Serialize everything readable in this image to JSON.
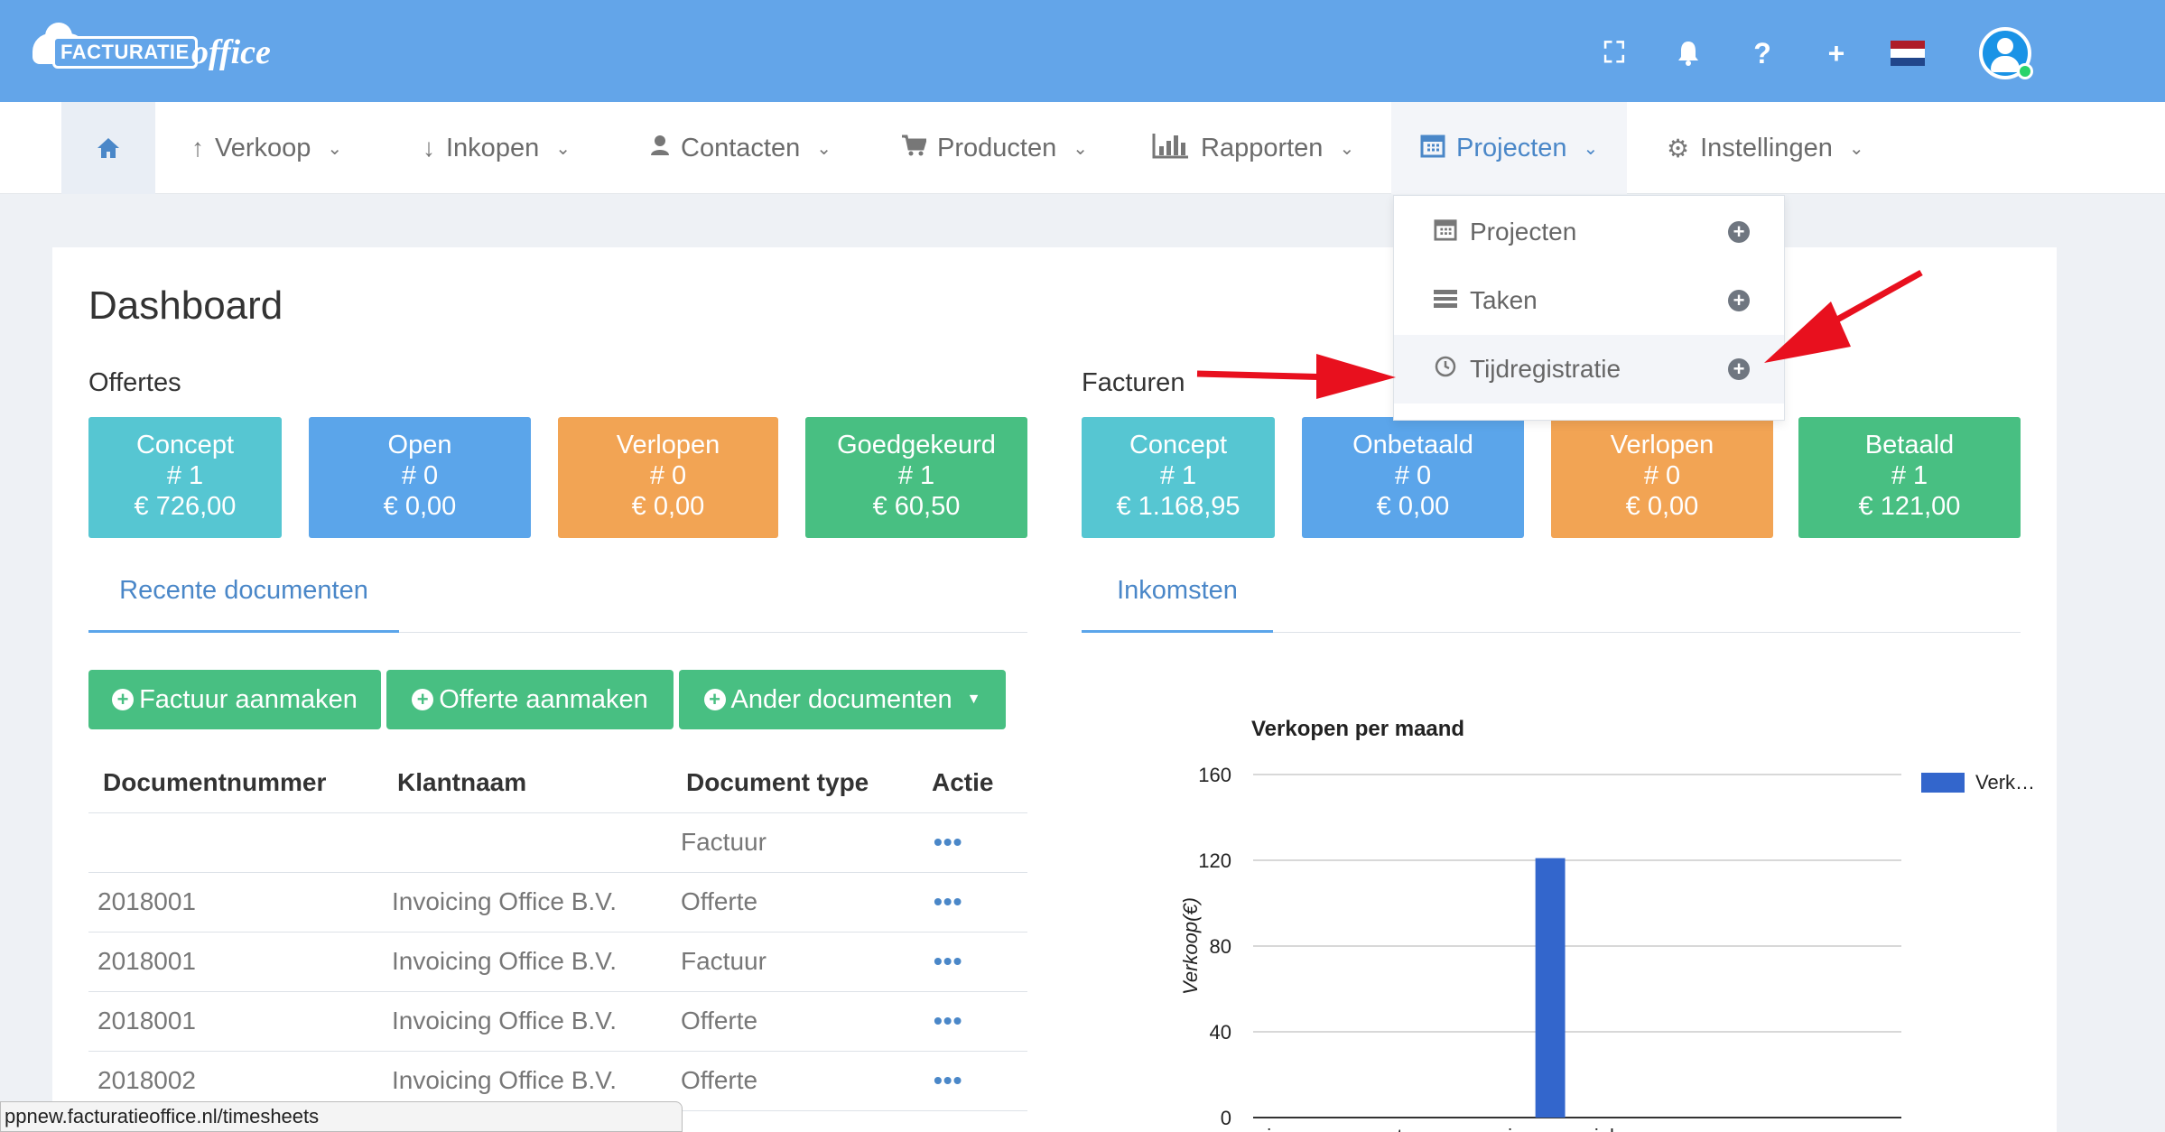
{
  "brand": {
    "box": "FACTURATIE",
    "script": "office"
  },
  "topbar": {
    "icons": [
      "fullscreen-icon",
      "bell-icon",
      "help-icon",
      "plus-icon"
    ],
    "icon_glyphs": [
      "⛶",
      "🔔",
      "?",
      "+"
    ],
    "flag_colors": [
      "#ae1c28",
      "#ffffff",
      "#21468b"
    ]
  },
  "nav": {
    "items": [
      {
        "label": "Verkoop",
        "icon": "arrow-up-icon",
        "glyph": "↑"
      },
      {
        "label": "Inkopen",
        "icon": "arrow-down-icon",
        "glyph": "↓"
      },
      {
        "label": "Contacten",
        "icon": "user-icon",
        "glyph": "👤"
      },
      {
        "label": "Producten",
        "icon": "cart-icon",
        "glyph": "🛒"
      },
      {
        "label": "Rapporten",
        "icon": "bar-chart-icon",
        "glyph": "📊"
      },
      {
        "label": "Projecten",
        "icon": "calendar-icon",
        "glyph": "📅"
      },
      {
        "label": "Instellingen",
        "icon": "gear-icon",
        "glyph": "⚙"
      }
    ]
  },
  "dropdown": {
    "items": [
      {
        "label": "Projecten",
        "icon": "calendar-icon",
        "glyph": "📅"
      },
      {
        "label": "Taken",
        "icon": "list-icon",
        "glyph": "☰"
      },
      {
        "label": "Tijdregistratie",
        "icon": "clock-icon",
        "glyph": "◷"
      }
    ]
  },
  "dashboard": {
    "title": "Dashboard",
    "offertes": {
      "label": "Offertes",
      "tiles": [
        {
          "name": "Concept",
          "count": "# 1",
          "amount": "€ 726,00"
        },
        {
          "name": "Open",
          "count": "# 0",
          "amount": "€ 0,00"
        },
        {
          "name": "Verlopen",
          "count": "# 0",
          "amount": "€ 0,00"
        },
        {
          "name": "Goedgekeurd",
          "count": "# 1",
          "amount": "€ 60,50"
        }
      ]
    },
    "facturen": {
      "label": "Facturen",
      "tiles": [
        {
          "name": "Concept",
          "count": "# 1",
          "amount": "€ 1.168,95"
        },
        {
          "name": "Onbetaald",
          "count": "# 0",
          "amount": "€ 0,00"
        },
        {
          "name": "Verlopen",
          "count": "# 0",
          "amount": "€ 0,00"
        },
        {
          "name": "Betaald",
          "count": "# 1",
          "amount": "€ 121,00"
        }
      ]
    },
    "tabs": {
      "left": "Recente documenten",
      "right": "Inkomsten"
    },
    "buttons": {
      "factuur": "Factuur aanmaken",
      "offerte": "Offerte aanmaken",
      "ander": "Ander documenten"
    },
    "table": {
      "headers": [
        "Documentnummer",
        "Klantnaam",
        "Document type",
        "Actie"
      ],
      "rows": [
        [
          "",
          "",
          "Factuur",
          "•••"
        ],
        [
          "2018001",
          "Invoicing Office B.V.",
          "Offerte",
          "•••"
        ],
        [
          "2018001",
          "Invoicing Office B.V.",
          "Factuur",
          "•••"
        ],
        [
          "2018001",
          "Invoicing Office B.V.",
          "Offerte",
          "•••"
        ],
        [
          "2018002",
          "Invoicing Office B.V.",
          "Offerte",
          "•••"
        ]
      ]
    }
  },
  "chart_data": {
    "type": "bar",
    "title": "Verkopen per maand",
    "ylabel": "Verkoop(€)",
    "xlabel": "",
    "ylim": [
      0,
      160
    ],
    "yticks": [
      0,
      40,
      80,
      120,
      160
    ],
    "categories": [
      "jan",
      "feb",
      "mrt",
      "apr",
      "mei",
      "jun",
      "jul",
      "aug",
      "sep",
      "okt",
      "nov",
      "dec"
    ],
    "tick_labels": [
      "jan",
      "mrt",
      "mei",
      "jul",
      "sep",
      "nov"
    ],
    "series": [
      {
        "name": "Verk…",
        "values": [
          0,
          0,
          0,
          0,
          0,
          121,
          0,
          0,
          0,
          0,
          0,
          0
        ],
        "color": "#3366cc"
      }
    ],
    "legend": "right",
    "grid": true
  },
  "status_bar": "ppnew.facturatieoffice.nl/timesheets",
  "annotations": {
    "arrow_color": "#e8101e"
  }
}
